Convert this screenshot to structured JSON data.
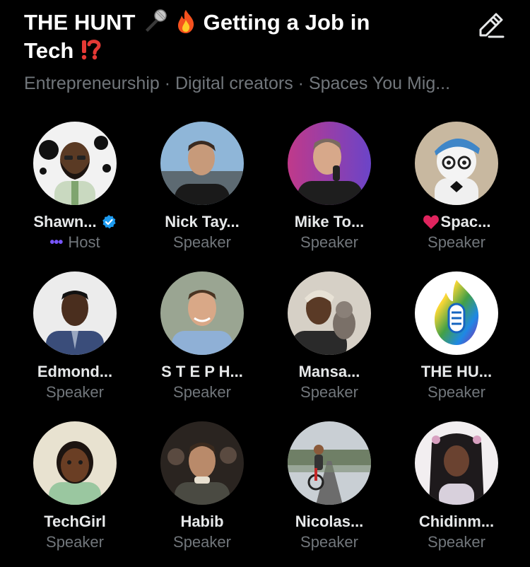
{
  "space": {
    "title_part1": "THE HUNT",
    "title_part2": "Getting a Job in",
    "title_part3": "Tech",
    "subtitle": "Entrepreneurship · Digital creators · Spaces You Mig..."
  },
  "header_icons": {
    "mic": "microphone-icon",
    "fire": "fire-icon",
    "exclaim": "exclamation-question-icon",
    "edit": "pencil-edit-icon"
  },
  "colors": {
    "background": "#000000",
    "verified": "#1d9bf0",
    "host_dots": "#7856ff",
    "secondary_text": "#71767b"
  },
  "participants": [
    {
      "name": "Shawn...",
      "role": "Host"
    },
    {
      "name": "Nick Tay...",
      "role": "Speaker"
    },
    {
      "name": "Mike To...",
      "role": "Speaker"
    },
    {
      "name": "Spac...",
      "role": "Speaker"
    },
    {
      "name": "Edmond...",
      "role": "Speaker"
    },
    {
      "name": "S T E P H...",
      "role": "Speaker"
    },
    {
      "name": "Mansa...",
      "role": "Speaker"
    },
    {
      "name": "THE HU...",
      "role": "Speaker"
    },
    {
      "name": "TechGirl",
      "role": "Speaker"
    },
    {
      "name": "Habib",
      "role": "Speaker"
    },
    {
      "name": "Nicolas...",
      "role": "Speaker"
    },
    {
      "name": "Chidinm...",
      "role": "Speaker"
    }
  ]
}
